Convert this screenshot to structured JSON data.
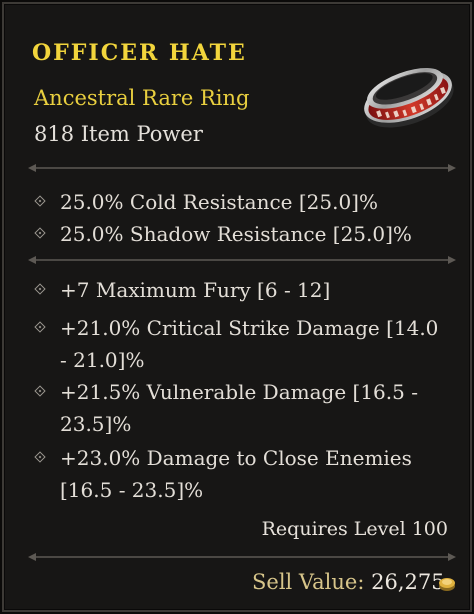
{
  "item": {
    "name": "Officer Hate",
    "type": "Ancestral Rare Ring",
    "item_power": "818 Item Power",
    "icon": "ring-icon"
  },
  "resistances": [
    "25.0% Cold Resistance [25.0]%",
    "25.0% Shadow Resistance [25.0]%"
  ],
  "affixes": [
    "+7 Maximum Fury [6 - 12]",
    "+21.0% Critical Strike Damage [14.0 - 21.0]%",
    "+21.5% Vulnerable Damage [16.5 - 23.5]%",
    "+23.0% Damage to Close Enemies [16.5 - 23.5]%"
  ],
  "footer": {
    "requirement": "Requires Level 100",
    "sell_label": "Sell Value:",
    "sell_value": "26,275",
    "currency_icon": "gold-coin-icon"
  },
  "colors": {
    "title": "#f2d53c",
    "rarity": "#e9cf3f",
    "background": "#171615"
  }
}
